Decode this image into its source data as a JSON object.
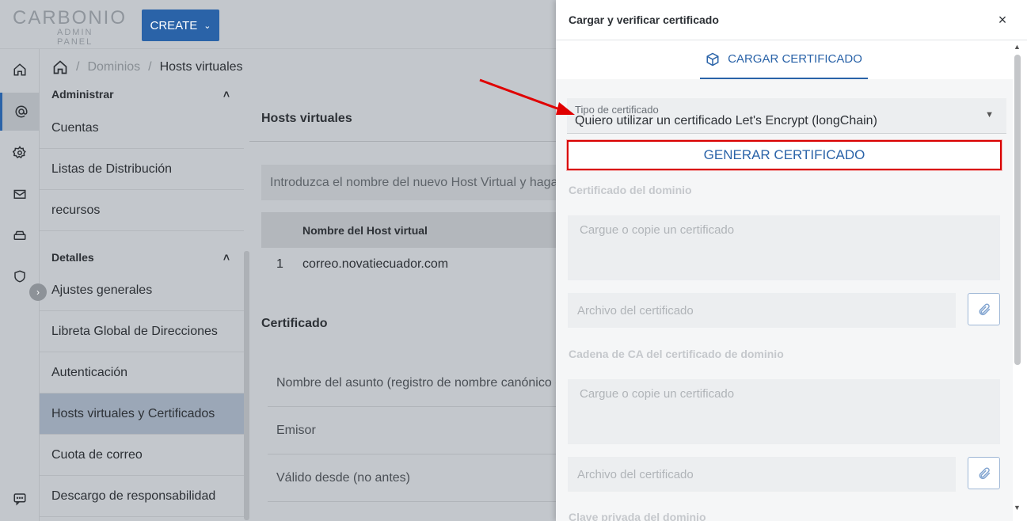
{
  "header": {
    "logo_main": "CARBONIO",
    "logo_sub": "ADMIN PANEL",
    "create_label": "CREATE",
    "create_caret": "⌄"
  },
  "breadcrumb": {
    "sep1": "/",
    "sep2": "/",
    "items": [
      "Dominios",
      "Hosts virtuales"
    ]
  },
  "subnav": {
    "section_admin": "Administrar",
    "section_details": "Detalles",
    "caret": "˄",
    "admin_items": [
      "Cuentas",
      "Listas de Distribución",
      "recursos"
    ],
    "detail_items": [
      "Ajustes generales",
      "Libreta Global de Direcciones",
      "Autenticación",
      "Hosts virtuales y Certificados",
      "Cuota de correo",
      "Descargo de responsabilidad"
    ],
    "expand_glyph": "›"
  },
  "main": {
    "title": "Hosts virtuales",
    "hint": "Introduzca el nombre del nuevo Host Virtual y haga",
    "table": {
      "header": "Nombre del Host virtual",
      "rows": [
        {
          "index": "1",
          "name": "correo.novatiecuador.com"
        }
      ]
    },
    "cert_title": "Certificado",
    "cert_rows": [
      "Nombre del asunto (registro de nombre canónico o",
      "Emisor",
      "Válido desde (no antes)"
    ]
  },
  "drawer": {
    "title": "Cargar y verificar certificado",
    "close_glyph": "×",
    "tab_label": "CARGAR CERTIFICADO",
    "select_label": "Tipo de certificado",
    "select_value": "Quiero utilizar un certificado Let's Encrypt (longChain)",
    "select_caret": "▼",
    "generate_label": "GENERAR CERTIFICADO",
    "domain_cert_label": "Certificado del dominio",
    "paste_placeholder": "Cargue o copie un certificado",
    "file_placeholder": "Archivo del certificado",
    "ca_chain_label": "Cadena de CA del certificado de dominio",
    "private_key_label": "Clave privada del dominio",
    "scroll_up": "▲",
    "scroll_down": "▼"
  },
  "colors": {
    "accent": "#2a63a8",
    "highlight": "#d90000"
  }
}
